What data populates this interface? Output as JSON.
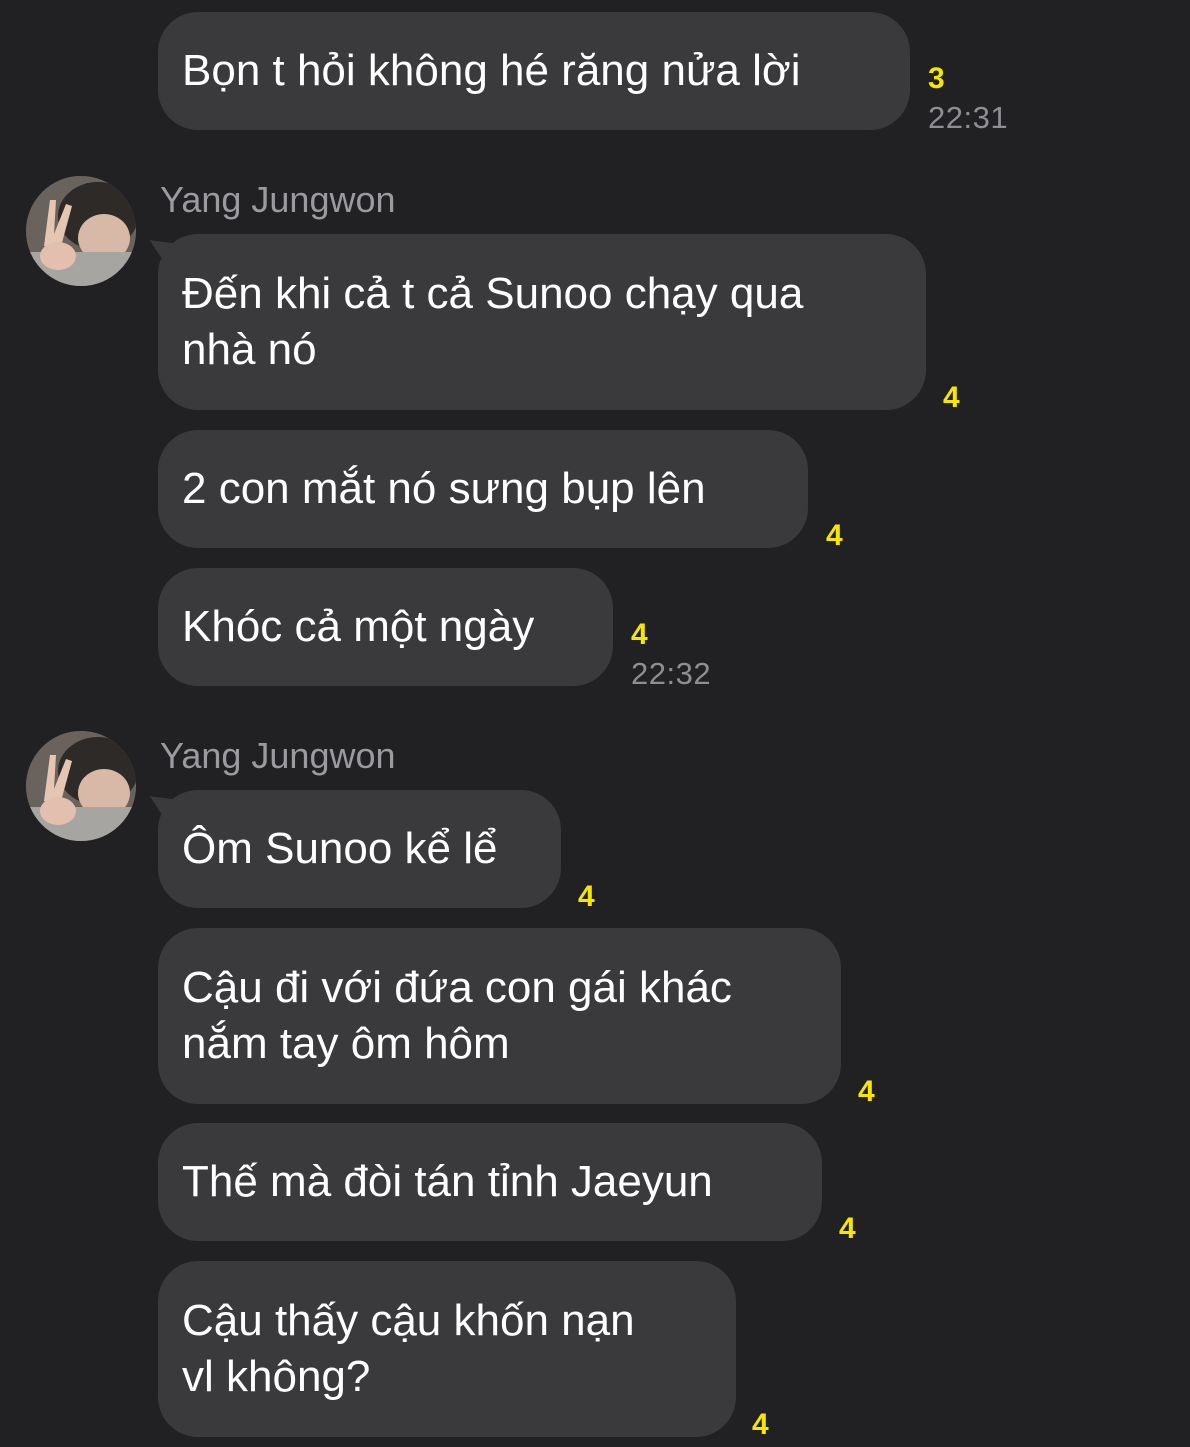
{
  "messages": [
    {
      "text": "Bọn t hỏi không hé răng nửa lời",
      "unread": "3",
      "time": "22:31"
    },
    {
      "sender": "Yang Jungwon",
      "text": "Đến khi cả t cả Sunoo chạy qua\nnhà nó",
      "unread": "4"
    },
    {
      "text": "2 con mắt nó sưng bụp lên",
      "unread": "4"
    },
    {
      "text": "Khóc cả một ngày",
      "unread": "4",
      "time": "22:32"
    },
    {
      "sender": "Yang Jungwon",
      "text": "Ôm Sunoo kể lể",
      "unread": "4"
    },
    {
      "text": "Cậu đi với đứa con gái khác\nnắm tay ôm hôm",
      "unread": "4"
    },
    {
      "text": "Thế mà đòi tán tỉnh Jaeyun",
      "unread": "4"
    },
    {
      "text": "Cậu thấy cậu khốn nạn\nvl không?",
      "unread": "4"
    }
  ],
  "colors": {
    "background": "#212124",
    "bubble": "#3a3a3c",
    "unread": "#f7e600",
    "time": "#8e8e93",
    "sender": "#9a9a9f"
  }
}
